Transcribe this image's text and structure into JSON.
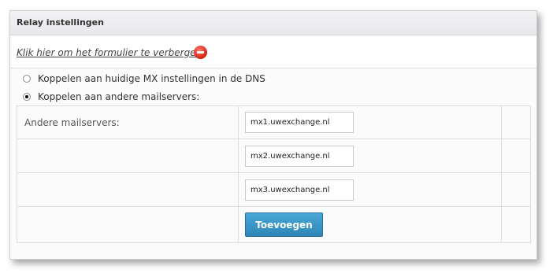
{
  "panel": {
    "title": "Relay instellingen"
  },
  "toggle": {
    "link_text": "Klik hier om het formulier te verbergen."
  },
  "options": [
    {
      "label": "Koppelen aan huidige MX instellingen in de DNS",
      "checked": false
    },
    {
      "label": "Koppelen aan andere mailservers:",
      "checked": true
    }
  ],
  "servers": {
    "label": "Andere mailservers:",
    "values": [
      "mx1.uwexchange.nl",
      "mx2.uwexchange.nl",
      "mx3.uwexchange.nl"
    ]
  },
  "actions": {
    "add_label": "Toevoegen"
  },
  "colors": {
    "accent": "#3a96c8",
    "remove": "#e02a1a"
  }
}
